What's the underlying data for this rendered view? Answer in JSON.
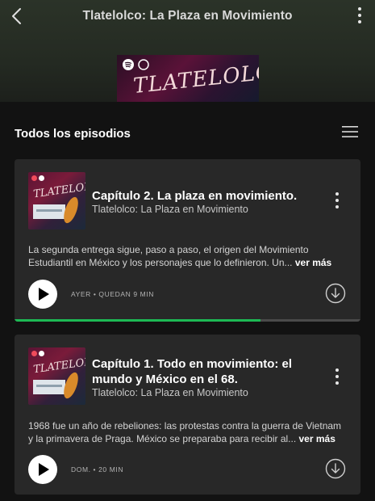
{
  "header": {
    "title": "Tlatelolco: La Plaza en Movimiento",
    "cover_text": "TLATELOLCO"
  },
  "section": {
    "title": "Todos los episodios"
  },
  "episodes": [
    {
      "title": "Capítulo 2. La plaza en movimiento.",
      "show": "Tlatelolco: La Plaza en Movimiento",
      "description": "La segunda entrega sigue, paso a paso, el origen del Movimiento Estudiantil en México y los personajes que lo definieron. Un...",
      "more_link": "ver más",
      "meta": "AYER • QUEDAN 9 MIN",
      "progress": 0.71,
      "thumb_text": "TLATELOLCO"
    },
    {
      "title": "Capítulo 1. Todo en movimiento: el mundo y México en el 68.",
      "show": "Tlatelolco: La Plaza en Movimiento",
      "description": "1968 fue un año de rebeliones: las protestas contra la guerra de Vietnam y la primavera de Praga. México se preparaba para recibir al...",
      "more_link": "ver más",
      "meta": "DOM. • 20 MIN",
      "thumb_text": "TLATELOLCO"
    }
  ],
  "colors": {
    "background": "#121212",
    "card": "#282828",
    "accent": "#1db954"
  },
  "icons": {
    "back": "chevron-left-icon",
    "more": "more-vertical-icon",
    "filter": "filter-lines-icon",
    "play": "play-icon",
    "download": "download-icon"
  }
}
